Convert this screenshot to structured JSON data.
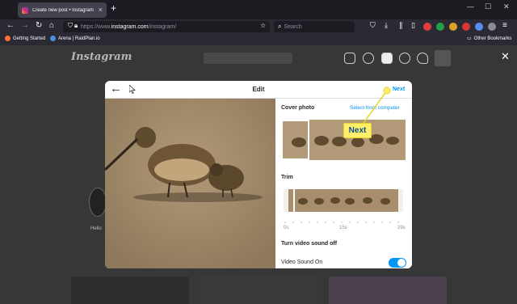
{
  "browser": {
    "tab_title": "Create new post • Instagram",
    "url_prefix": "https://www.",
    "url_domain": "instagram.com",
    "url_path": "/instagram/",
    "search_placeholder": "Search",
    "bookmarks": [
      {
        "label": "Getting Started",
        "color": "#ff7139"
      },
      {
        "label": "Arena | RaidPlan.io",
        "color": "#4a90e2"
      }
    ],
    "other_bookmarks": "Other Bookmarks"
  },
  "instagram": {
    "logo": "Instagram",
    "story_label": "Hello"
  },
  "modal": {
    "title": "Edit",
    "next_label": "Next",
    "cover_photo_label": "Cover photo",
    "select_from_computer": "Select from computer",
    "trim_label": "Trim",
    "timeline_labels": [
      "0s",
      "15s",
      "29s"
    ],
    "sound_heading": "Turn video sound off",
    "sound_toggle_label": "Video Sound On",
    "sound_on": true
  },
  "callout": {
    "label": "Next",
    "color": "#fff06a"
  }
}
